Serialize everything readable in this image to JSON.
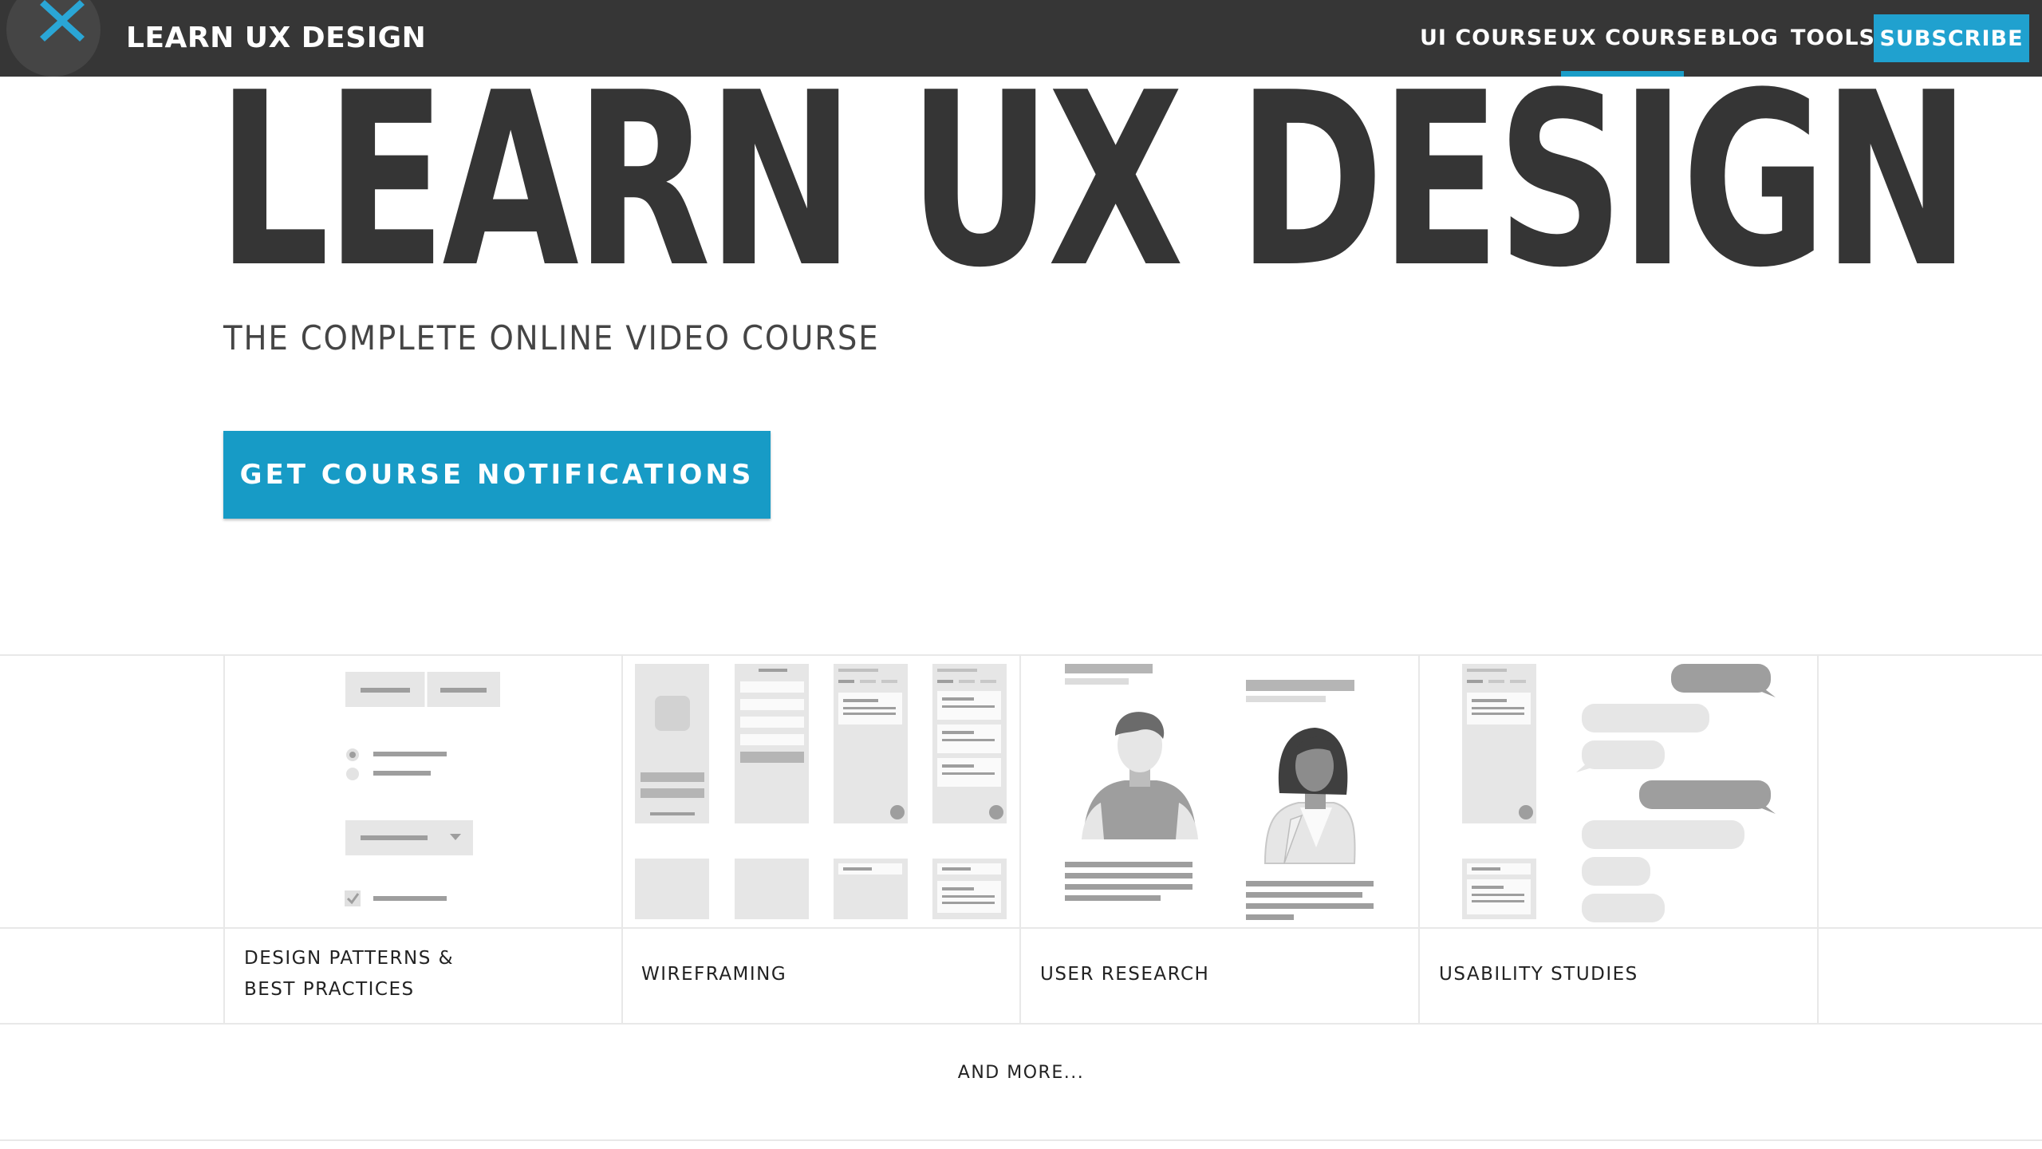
{
  "nav": {
    "brand": "LEARN UX DESIGN",
    "links": [
      {
        "label": "UI COURSE"
      },
      {
        "label": "UX COURSE",
        "active": true
      },
      {
        "label": "BLOG"
      },
      {
        "label": "TOOLS"
      }
    ],
    "subscribe": "SUBSCRIBE",
    "logo_icon": "x-logo-icon"
  },
  "hero": {
    "title": "LEARN UX DESIGN",
    "subtitle": "THE COMPLETE ONLINE VIDEO COURSE",
    "cta": "GET COURSE NOTIFICATIONS"
  },
  "topics": [
    {
      "label_line1": "DESIGN PATTERNS &",
      "label_line2": "BEST PRACTICES",
      "illustration": "form-controls-illustration"
    },
    {
      "label_line1": "WIREFRAMING",
      "label_line2": "",
      "illustration": "wireframe-screens-illustration"
    },
    {
      "label_line1": "USER RESEARCH",
      "label_line2": "",
      "illustration": "personas-illustration"
    },
    {
      "label_line1": "USABILITY STUDIES",
      "label_line2": "",
      "illustration": "chat-bubbles-illustration"
    }
  ],
  "more": "AND MORE...",
  "colors": {
    "nav_bg": "#363636",
    "accent": "#1a9dc7",
    "text_dark": "#353535",
    "grid_line": "#e8e8e8"
  }
}
